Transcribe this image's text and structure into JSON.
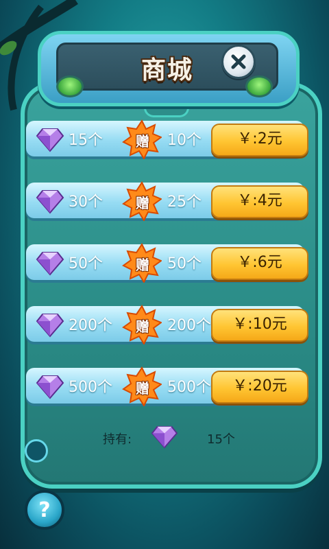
{
  "title": "商城",
  "close_icon": "close-icon",
  "bonus_label": "赠",
  "rows": [
    {
      "qty": "15个",
      "bonus": "10个",
      "price": "￥:2元"
    },
    {
      "qty": "30个",
      "bonus": "25个",
      "price": "￥:4元"
    },
    {
      "qty": "50个",
      "bonus": "50个",
      "price": "￥:6元"
    },
    {
      "qty": "200个",
      "bonus": "200个",
      "price": "￥:10元"
    },
    {
      "qty": "500个",
      "bonus": "500个",
      "price": "￥:20元"
    }
  ],
  "holding": {
    "label": "持有:",
    "count": "15个"
  },
  "help_label": "?",
  "colors": {
    "accent": "#ffc532",
    "panel": "#2a8b86",
    "row": "#97dcf3"
  }
}
